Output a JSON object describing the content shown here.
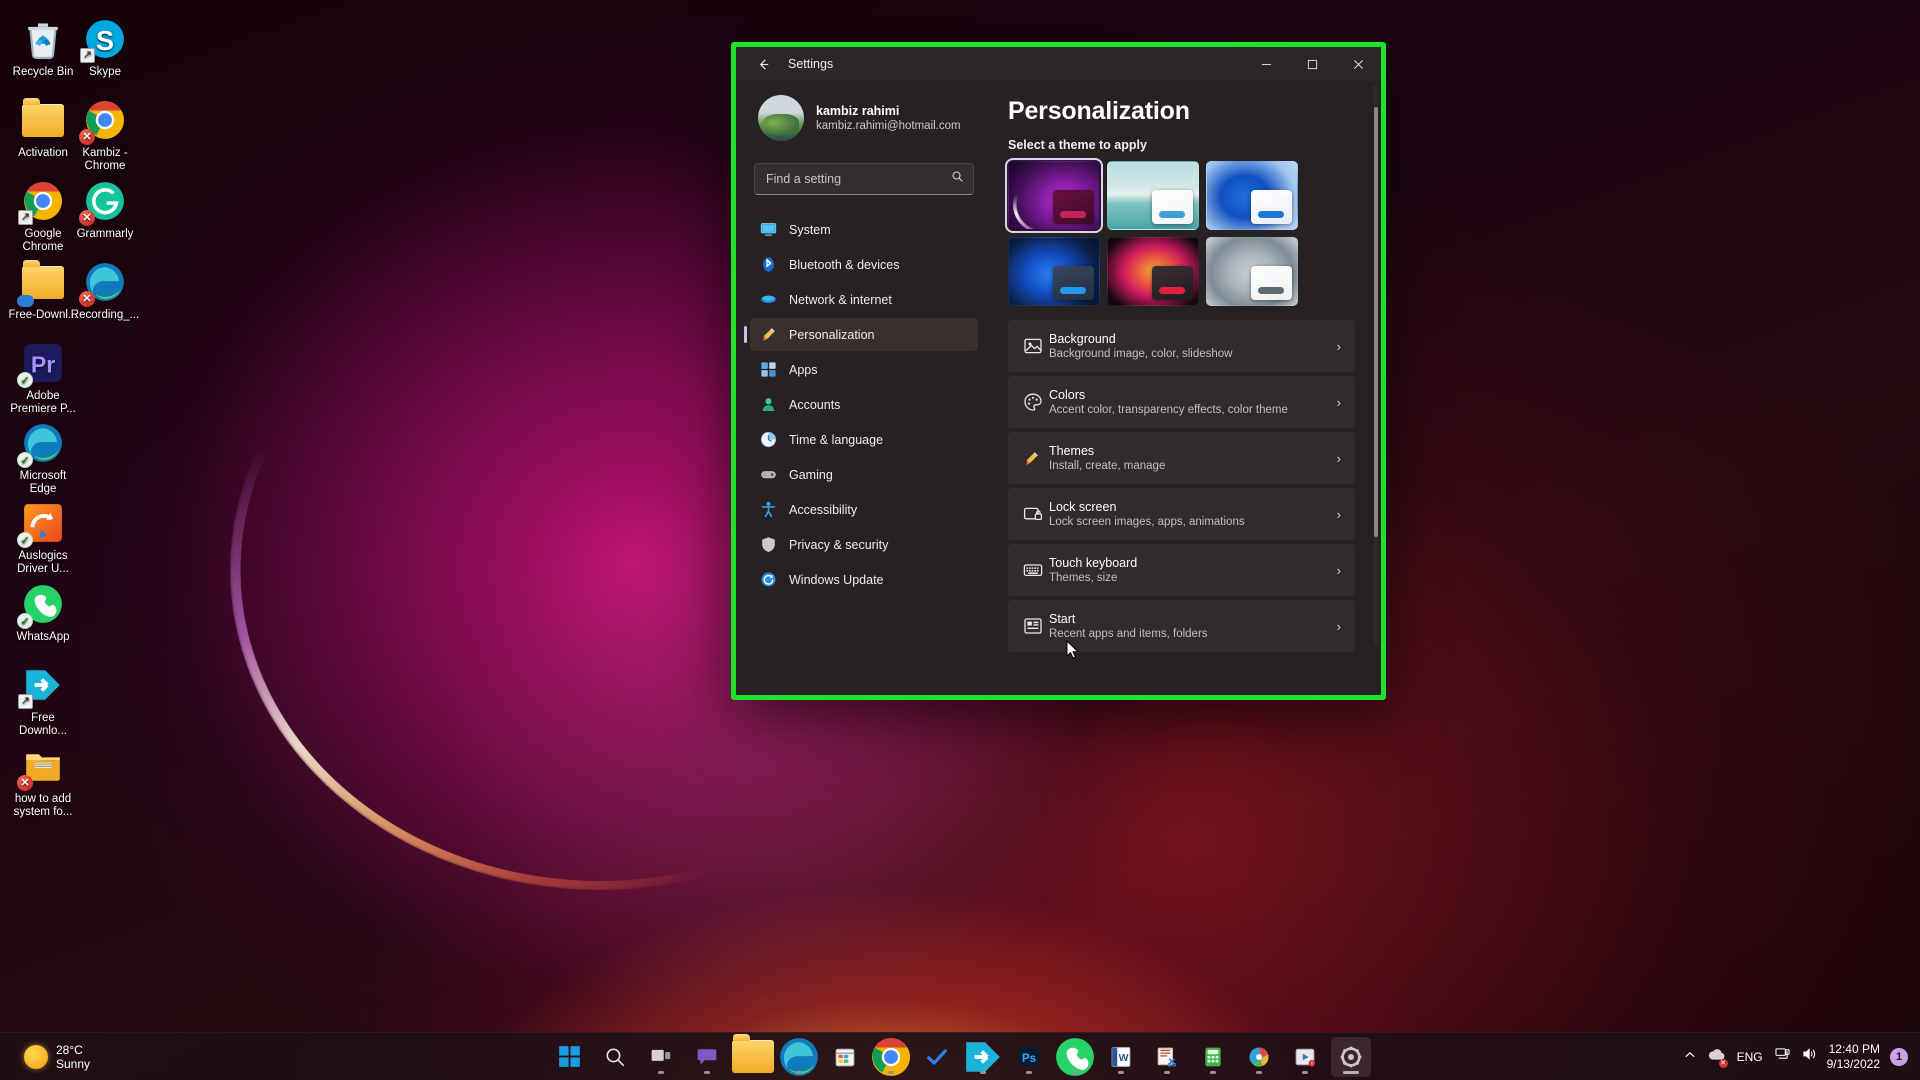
{
  "desktop": {
    "icons": [
      {
        "label": "Recycle Bin",
        "icon": "recycle-bin-icon",
        "badge": "none",
        "col": 0,
        "row": 0
      },
      {
        "label": "Skype",
        "icon": "skype-icon",
        "badge": "shortcut",
        "col": 1,
        "row": 0
      },
      {
        "label": "Activation",
        "icon": "folder-icon",
        "badge": "none",
        "col": 0,
        "row": 1
      },
      {
        "label": "Kambiz - Chrome",
        "icon": "chrome-icon",
        "badge": "error",
        "col": 1,
        "row": 1
      },
      {
        "label": "Google Chrome",
        "icon": "chrome-icon",
        "badge": "shortcut",
        "col": 0,
        "row": 2
      },
      {
        "label": "Grammarly",
        "icon": "grammarly-icon",
        "badge": "error",
        "col": 1,
        "row": 2
      },
      {
        "label": "Free-Downl...",
        "icon": "folder-icon",
        "badge": "cloud",
        "col": 0,
        "row": 3
      },
      {
        "label": "Recording_...",
        "icon": "edge-icon",
        "badge": "error",
        "col": 1,
        "row": 3
      },
      {
        "label": "Adobe Premiere P...",
        "icon": "premiere-icon",
        "badge": "check",
        "col": 0,
        "row": 4
      },
      {
        "label": "Microsoft Edge",
        "icon": "edge-icon",
        "badge": "check",
        "col": 0,
        "row": 5
      },
      {
        "label": "Auslogics Driver U...",
        "icon": "auslogics-icon",
        "badge": "check",
        "col": 0,
        "row": 6
      },
      {
        "label": "WhatsApp",
        "icon": "whatsapp-icon",
        "badge": "check",
        "col": 0,
        "row": 7
      },
      {
        "label": "Free Downlo...",
        "icon": "free-download-manager-icon",
        "badge": "shortcut",
        "col": 0,
        "row": 8
      },
      {
        "label": "how to add system fo...",
        "icon": "zip-folder-icon",
        "badge": "error",
        "col": 0,
        "row": 9
      }
    ]
  },
  "taskbar": {
    "weather": {
      "temperature": "28°C",
      "condition": "Sunny",
      "icon": "sun-icon"
    },
    "items": [
      {
        "name": "start-button",
        "icon": "windows-logo-icon",
        "running": false
      },
      {
        "name": "search-button",
        "icon": "search-icon",
        "running": false
      },
      {
        "name": "task-view-button",
        "icon": "task-view-icon",
        "running": true
      },
      {
        "name": "teams-chat-button",
        "icon": "chat-icon",
        "running": true
      },
      {
        "name": "file-explorer-button",
        "icon": "folder-icon",
        "running": false
      },
      {
        "name": "microsoft-edge-button",
        "icon": "edge-icon",
        "running": true
      },
      {
        "name": "microsoft-store-button",
        "icon": "store-icon",
        "running": false
      },
      {
        "name": "google-chrome-button",
        "icon": "chrome-icon",
        "running": true
      },
      {
        "name": "todo-button",
        "icon": "checkmark-icon",
        "running": false
      },
      {
        "name": "free-download-manager-button",
        "icon": "free-download-manager-icon",
        "running": true
      },
      {
        "name": "photoshop-button",
        "icon": "photoshop-icon",
        "running": true
      },
      {
        "name": "whatsapp-button",
        "icon": "whatsapp-icon",
        "running": true
      },
      {
        "name": "word-button",
        "icon": "word-icon",
        "running": true
      },
      {
        "name": "snipping-tool-button",
        "icon": "snipping-tool-icon",
        "running": true
      },
      {
        "name": "calculator-button",
        "icon": "calculator-icon",
        "running": true
      },
      {
        "name": "paint-button",
        "icon": "paint-icon",
        "running": true
      },
      {
        "name": "media-player-button",
        "icon": "media-player-icon",
        "running": true
      },
      {
        "name": "settings-button",
        "icon": "gear-icon",
        "running": true
      }
    ],
    "tray": {
      "show_hidden_icons": "⌃",
      "language": "ENG",
      "network_icon": "network-icon",
      "volume_icon": "volume-icon",
      "time": "12:40 PM",
      "date": "9/13/2022",
      "notification_count": "1"
    }
  },
  "settings_window": {
    "title": "Settings",
    "back_label": "←",
    "controls": {
      "minimize": "–",
      "maximize": "❐",
      "close": "✕"
    },
    "account": {
      "name": "kambiz rahimi",
      "email": "kambiz.rahimi@hotmail.com",
      "avatar": "user-avatar"
    },
    "search": {
      "placeholder": "Find a setting",
      "value": "",
      "icon": "search-icon"
    },
    "nav": [
      {
        "label": "System",
        "icon": "system-icon",
        "selected": false
      },
      {
        "label": "Bluetooth & devices",
        "icon": "bluetooth-icon",
        "selected": false
      },
      {
        "label": "Network & internet",
        "icon": "wifi-icon",
        "selected": false
      },
      {
        "label": "Personalization",
        "icon": "paintbrush-icon",
        "selected": true
      },
      {
        "label": "Apps",
        "icon": "apps-icon",
        "selected": false
      },
      {
        "label": "Accounts",
        "icon": "account-icon",
        "selected": false
      },
      {
        "label": "Time & language",
        "icon": "clock-icon",
        "selected": false
      },
      {
        "label": "Gaming",
        "icon": "gamepad-icon",
        "selected": false
      },
      {
        "label": "Accessibility",
        "icon": "accessibility-icon",
        "selected": false
      },
      {
        "label": "Privacy & security",
        "icon": "shield-icon",
        "selected": false
      },
      {
        "label": "Windows Update",
        "icon": "update-icon",
        "selected": false
      }
    ],
    "page": {
      "title": "Personalization",
      "theme_section_label": "Select a theme to apply",
      "themes": [
        {
          "name": "windows-light-purple-theme",
          "selected": true
        },
        {
          "name": "glow-beach-theme",
          "selected": false
        },
        {
          "name": "windows-bloom-light-theme",
          "selected": false
        },
        {
          "name": "windows-bloom-dark-theme",
          "selected": false
        },
        {
          "name": "flow-dark-theme",
          "selected": false
        },
        {
          "name": "captured-motion-light-theme",
          "selected": false
        }
      ],
      "rows": [
        {
          "title": "Background",
          "subtitle": "Background image, color, slideshow",
          "icon": "image-icon"
        },
        {
          "title": "Colors",
          "subtitle": "Accent color, transparency effects, color theme",
          "icon": "palette-icon"
        },
        {
          "title": "Themes",
          "subtitle": "Install, create, manage",
          "icon": "paintbrush-icon"
        },
        {
          "title": "Lock screen",
          "subtitle": "Lock screen images, apps, animations",
          "icon": "lock-screen-icon"
        },
        {
          "title": "Touch keyboard",
          "subtitle": "Themes, size",
          "icon": "keyboard-icon"
        },
        {
          "title": "Start",
          "subtitle": "Recent apps and items, folders",
          "icon": "start-layout-icon"
        }
      ],
      "chevron": "›"
    },
    "highlight_color": "#1fe32a"
  }
}
